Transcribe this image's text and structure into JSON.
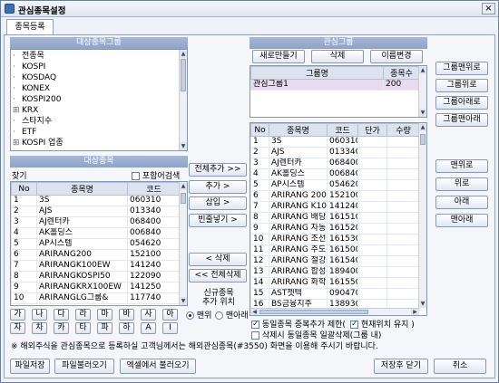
{
  "window": {
    "title": "관심종목설정",
    "close": "×"
  },
  "tab": {
    "label": "종목등록"
  },
  "source_group": {
    "header": "대상종목그룹",
    "items": [
      "전종목",
      "KOSPI",
      "KOSDAQ",
      "KONEX",
      "KOSPI200",
      "KRX",
      "스타지수",
      "ETF",
      "KOSPI 업종"
    ]
  },
  "source_list": {
    "header": "대상종목",
    "search_label": "찾기",
    "include_search_label": "포함어검색",
    "columns": [
      "No",
      "종목명",
      "코드"
    ],
    "rows": [
      [
        "1",
        "3S",
        "060310"
      ],
      [
        "2",
        "AJS",
        "013340"
      ],
      [
        "3",
        "AJ렌터카",
        "068400"
      ],
      [
        "4",
        "AK홀딩스",
        "006840"
      ],
      [
        "5",
        "AP시스템",
        "054620"
      ],
      [
        "6",
        "ARIRANG200",
        "152100"
      ],
      [
        "7",
        "ARIRANGK100EW",
        "141240"
      ],
      [
        "8",
        "ARIRANGKOSPI50",
        "122090"
      ],
      [
        "9",
        "ARIRANGKRX100EW",
        "141250"
      ],
      [
        "10",
        "ARIRANGLG그룹&",
        "117740"
      ]
    ],
    "keys": [
      [
        "가",
        "나",
        "다",
        "라",
        "마",
        "바",
        "사",
        "아"
      ],
      [
        "자",
        "차",
        "카",
        "타",
        "파",
        "하",
        "A",
        "I"
      ]
    ]
  },
  "middle_buttons": {
    "add_all": "전체추가 >>",
    "add": "추가 >",
    "insert": "삽입 >",
    "blank": "빈줄넣기 >",
    "delete": "< 삭제",
    "delete_all": "<< 전체삭제",
    "position_label": "신규종목\n추가 위치",
    "position_top": "맨위",
    "position_bottom": "맨아래"
  },
  "interest_group": {
    "header": "관심그룹",
    "new_btn": "새로만들기",
    "delete_btn": "삭제",
    "rename_btn": "이름변경",
    "columns": [
      "그룹명",
      "종목수"
    ],
    "rows": [
      [
        "관심그룹1",
        "200"
      ]
    ]
  },
  "group_order_buttons": [
    "그룹맨위로",
    "그룹위로",
    "그룹아래로",
    "그룹맨아래"
  ],
  "interest_list": {
    "columns": [
      "No",
      "종목명",
      "코드",
      "단가",
      "수량"
    ],
    "rows": [
      [
        "1",
        "3S",
        "060310"
      ],
      [
        "2",
        "AJS",
        "013340"
      ],
      [
        "3",
        "AJ렌터카",
        "068400"
      ],
      [
        "4",
        "AK홀딩스",
        "006840"
      ],
      [
        "5",
        "AP시스템",
        "054620"
      ],
      [
        "6",
        "ARIRANG 200",
        "152100"
      ],
      [
        "7",
        "ARIRANG K100E",
        "141240"
      ],
      [
        "8",
        "ARIRANG 배당주",
        "161510"
      ],
      [
        "9",
        "ARIRANG 자동차",
        "161520"
      ],
      [
        "10",
        "ARIRANG 조선중",
        "161530"
      ],
      [
        "11",
        "ARIRANG 주도주",
        "161500"
      ],
      [
        "12",
        "ARIRANG 철강금",
        "161540"
      ],
      [
        "13",
        "ARIRANG 합성-",
        "189400"
      ],
      [
        "14",
        "ARIRANG 화학",
        "161550"
      ],
      [
        "15",
        "AST젯텍",
        "090470"
      ],
      [
        "16",
        "BS금융지주",
        "138930"
      ]
    ],
    "dup_label": "동일종목 중복추가 제한(",
    "keep_pos_label": "현재위치 유지 )",
    "delete_all_groups_label": "삭제시 동일종목 일괄삭제(그룹 내)"
  },
  "order_buttons": [
    "맨위로",
    "위로",
    "아래",
    "맨아래"
  ],
  "notice": "※ 해외주식을 관심종목으로 등록하실 고객님께서는 해외관심종목(#3550) 화면을 이용해 주시기 바랍니다.",
  "footer": {
    "file_save": "파일저장",
    "file_load": "파일불러오기",
    "excel_load": "엑셀에서 불러오기",
    "save_close": "저장후 닫기",
    "cancel": "취소"
  }
}
